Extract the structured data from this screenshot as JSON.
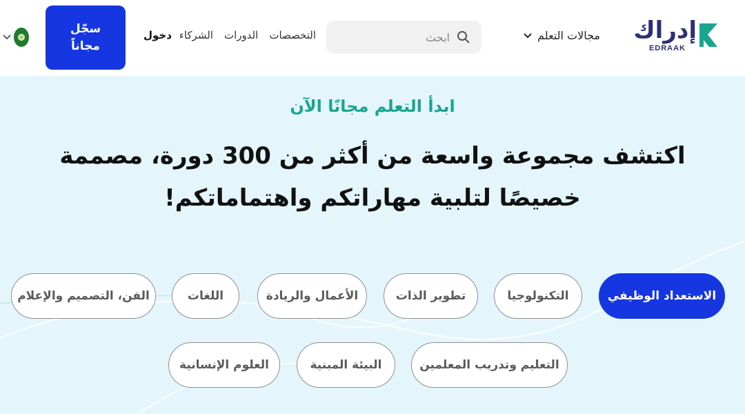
{
  "header": {
    "logo_text": "إدراك",
    "logo_sub": "EDRAAK",
    "learn_areas_label": "مجالات التعلم",
    "search_placeholder": "ابحث",
    "nav": [
      "التخصصات",
      "الدورات",
      "الشركاء"
    ],
    "login_label": "دخول",
    "register_label": "سجّل\nمجاناً",
    "brand_color": "#1536e0"
  },
  "hero": {
    "tagline": "ابدأ التعلم مجانًا الآن",
    "headline": "اكتشف مجموعة واسعة من أكثر من 300 دورة، مصممة خصيصًا لتلبية مهاراتكم واهتماماتكم!"
  },
  "categories": [
    "الاستعداد الوظيفي",
    "التكنولوجيا",
    "تطوير الذات",
    "الأعمال والريادة",
    "اللغات",
    "الفن، التصميم والإعلام",
    "التعليم وتدريب المعلمين",
    "البيئة المبنية",
    "العلوم الإنسانية"
  ]
}
